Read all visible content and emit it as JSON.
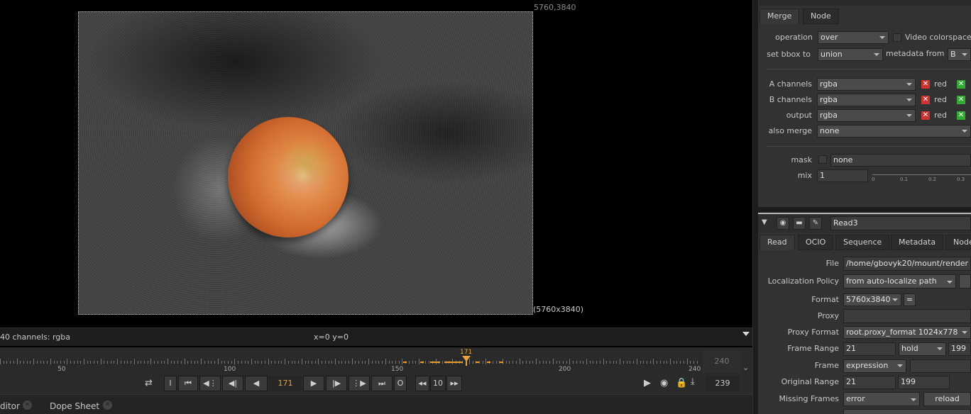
{
  "viewer": {
    "top_right_coord": "5760,3840",
    "format_label": "(5760x3840)"
  },
  "infobar": {
    "channels": "40 channels: rgba",
    "cursor": "x=0 y=0"
  },
  "timeline": {
    "tick_labels": [
      "50",
      "100",
      "150",
      "200",
      "240"
    ],
    "current_frame_marker": "171",
    "end_frame_box": "240",
    "current_frame": "171",
    "skip_increment": "10",
    "end_frame": "239",
    "in_button": "I",
    "out_button": "O"
  },
  "bottom_tabs": [
    {
      "label": "ditor"
    },
    {
      "label": "Dope Sheet"
    }
  ],
  "merge_panel": {
    "tabs": [
      "Merge",
      "Node"
    ],
    "operation_label": "operation",
    "operation_value": "over",
    "video_colorspace_label": "Video colorspace",
    "set_bbox_label": "set bbox to",
    "set_bbox_value": "union",
    "metadata_from_label": "metadata from",
    "metadata_from_value": "B",
    "a_channels_label": "A channels",
    "a_channels_value": "rgba",
    "b_channels_label": "B channels",
    "b_channels_value": "rgba",
    "output_label": "output",
    "output_value": "rgba",
    "red_label": "red",
    "also_merge_label": "also merge",
    "also_merge_value": "none",
    "mask_label": "mask",
    "mask_value": "none",
    "mix_label": "mix",
    "mix_value": "1",
    "mix_ticks": [
      "0",
      "0.1",
      "0.2",
      "0.3"
    ]
  },
  "read_panel": {
    "node_name": "Read3",
    "tabs": [
      "Read",
      "OCIO",
      "Sequence",
      "Metadata",
      "Node"
    ],
    "file_label": "File",
    "file_value": "/home/gbovyk20/mount/render",
    "localization_label": "Localization Policy",
    "localization_value": "from auto-localize path",
    "format_label": "Format",
    "format_value": "5760x3840",
    "format_eq": "=",
    "proxy_label": "Proxy",
    "proxy_value": "",
    "proxy_format_label": "Proxy Format",
    "proxy_format_value": "root.proxy_format 1024x778",
    "frame_range_label": "Frame Range",
    "frame_range_start": "21",
    "frame_range_mode": "hold",
    "frame_range_end": "199",
    "frame_label": "Frame",
    "frame_mode": "expression",
    "original_range_label": "Original Range",
    "original_range_start": "21",
    "original_range_end": "199",
    "missing_frames_label": "Missing Frames",
    "missing_frames_value": "error",
    "reload_button": "reload"
  },
  "colors": {
    "accent_orange": "#e8a33a",
    "panel_bg": "#323232",
    "viewer_bg": "#000000"
  }
}
